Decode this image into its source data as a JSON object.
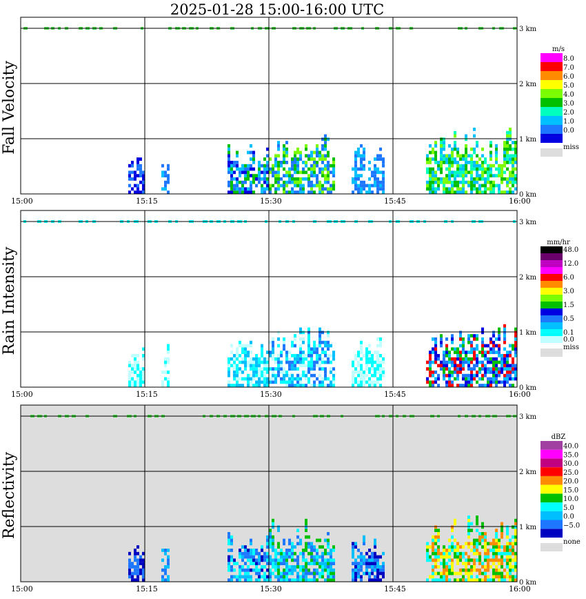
{
  "title": "2025-01-28   15:00-16:00 UTC",
  "chart_data": [
    {
      "type": "heatmap",
      "ylabel": "Fall Velocity",
      "x_ticks": [
        "15:00",
        "15:15",
        "15:30",
        "15:45",
        "16:00"
      ],
      "y_ticks": [
        "0 km",
        "1 km",
        "2 km",
        "3 km"
      ],
      "xlim": [
        "15:00",
        "16:00"
      ],
      "ylim": [
        0,
        3.2
      ],
      "grid": true,
      "background": "#ffffff",
      "legend": {
        "unit": "m/s",
        "placement": "right",
        "levels": [
          {
            "label": "8.0",
            "color": "#ff00ff"
          },
          {
            "label": "7.0",
            "color": "#ff0000"
          },
          {
            "label": "6.0",
            "color": "#ff8c00"
          },
          {
            "label": "5.0",
            "color": "#ffff00"
          },
          {
            "label": "4.0",
            "color": "#7cfc00"
          },
          {
            "label": "3.0",
            "color": "#00c000"
          },
          {
            "label": "2.0",
            "color": "#00ffbf"
          },
          {
            "label": "1.0",
            "color": "#00bfff"
          },
          {
            "label": "0.0",
            "color": "#1e78ff"
          },
          {
            "label": "",
            "color": "#0000e0"
          }
        ],
        "missing": {
          "label": "miss",
          "color": "#dddddd"
        }
      },
      "echoes": [
        {
          "t0": "15:13",
          "t1": "15:15",
          "z0": 0,
          "z1": 0.7,
          "colors": [
            "#0000e0",
            "#1e78ff"
          ]
        },
        {
          "t0": "15:17",
          "t1": "15:18",
          "z0": 0,
          "z1": 0.8,
          "colors": [
            "#1e78ff",
            "#00bfff"
          ]
        },
        {
          "t0": "15:25",
          "t1": "15:30",
          "z0": 0,
          "z1": 0.9,
          "colors": [
            "#1e78ff",
            "#00bfff",
            "#0000e0",
            "#00c000"
          ]
        },
        {
          "t0": "15:30",
          "t1": "15:38",
          "z0": 0,
          "z1": 1.1,
          "colors": [
            "#1e78ff",
            "#00bfff",
            "#00c000",
            "#7cfc00"
          ]
        },
        {
          "t0": "15:40",
          "t1": "15:44",
          "z0": 0,
          "z1": 0.9,
          "colors": [
            "#1e78ff",
            "#00bfff"
          ]
        },
        {
          "t0": "15:49",
          "t1": "16:00",
          "z0": 0,
          "z1": 1.2,
          "colors": [
            "#00bfff",
            "#00c000",
            "#7cfc00",
            "#00ffbf"
          ]
        }
      ]
    },
    {
      "type": "heatmap",
      "ylabel": "Rain Intensity",
      "x_ticks": [
        "15:00",
        "15:15",
        "15:30",
        "15:45",
        "16:00"
      ],
      "y_ticks": [
        "0 km",
        "1 km",
        "2 km",
        "3 km"
      ],
      "xlim": [
        "15:00",
        "16:00"
      ],
      "ylim": [
        0,
        3.2
      ],
      "grid": true,
      "background": "#ffffff",
      "legend": {
        "unit": "mm/hr",
        "placement": "right",
        "levels": [
          {
            "label": "48.0",
            "color": "#000000"
          },
          {
            "label": "",
            "color": "#6a006a"
          },
          {
            "label": "12.0",
            "color": "#c000c0"
          },
          {
            "label": "",
            "color": "#ff00ff"
          },
          {
            "label": "6.0",
            "color": "#ff0000"
          },
          {
            "label": "",
            "color": "#ff8c00"
          },
          {
            "label": "3.0",
            "color": "#ffff00"
          },
          {
            "label": "",
            "color": "#7cfc00"
          },
          {
            "label": "1.5",
            "color": "#00c000"
          },
          {
            "label": "",
            "color": "#0000e0"
          },
          {
            "label": "0.5",
            "color": "#1e78ff"
          },
          {
            "label": "",
            "color": "#00bfff"
          },
          {
            "label": "0.1",
            "color": "#00ffff"
          },
          {
            "label": "0.0",
            "color": "#bfffff"
          }
        ],
        "missing": {
          "label": "miss",
          "color": "#dddddd"
        }
      },
      "echoes": [
        {
          "t0": "15:13",
          "t1": "15:15",
          "z0": 0,
          "z1": 0.7,
          "colors": [
            "#00ffff",
            "#bfffff"
          ]
        },
        {
          "t0": "15:17",
          "t1": "15:18",
          "z0": 0,
          "z1": 0.8,
          "colors": [
            "#00ffff",
            "#bfffff"
          ]
        },
        {
          "t0": "15:25",
          "t1": "15:30",
          "z0": 0,
          "z1": 0.9,
          "colors": [
            "#00ffff",
            "#bfffff",
            "#00bfff"
          ]
        },
        {
          "t0": "15:30",
          "t1": "15:38",
          "z0": 0,
          "z1": 1.1,
          "colors": [
            "#00ffff",
            "#bfffff",
            "#00bfff",
            "#1e78ff"
          ]
        },
        {
          "t0": "15:40",
          "t1": "15:44",
          "z0": 0,
          "z1": 0.9,
          "colors": [
            "#00ffff",
            "#bfffff"
          ]
        },
        {
          "t0": "15:49",
          "t1": "16:00",
          "z0": 0,
          "z1": 1.2,
          "colors": [
            "#1e78ff",
            "#0000e0",
            "#00bfff",
            "#00c000",
            "#ff0000"
          ]
        }
      ]
    },
    {
      "type": "heatmap",
      "ylabel": "Reflectivity",
      "x_ticks": [
        "15:00",
        "15:15",
        "15:30",
        "15:45",
        "16:00"
      ],
      "y_ticks": [
        "0 km",
        "1 km",
        "2 km",
        "3 km"
      ],
      "xlim": [
        "15:00",
        "16:00"
      ],
      "ylim": [
        0,
        3.2
      ],
      "grid": true,
      "background": "#dddddd",
      "legend": {
        "unit": "dBZ",
        "placement": "right",
        "levels": [
          {
            "label": "40.0",
            "color": "#a040a0"
          },
          {
            "label": "35.0",
            "color": "#ff00ff"
          },
          {
            "label": "30.0",
            "color": "#c00080"
          },
          {
            "label": "25.0",
            "color": "#ff0000"
          },
          {
            "label": "20.0",
            "color": "#ff8c00"
          },
          {
            "label": "15.0",
            "color": "#ffff00"
          },
          {
            "label": "10.0",
            "color": "#00c000"
          },
          {
            "label": "5.0",
            "color": "#00ffff"
          },
          {
            "label": "0.0",
            "color": "#00bfff"
          },
          {
            "label": "−5.0",
            "color": "#1e78ff"
          },
          {
            "label": "",
            "color": "#0000c0"
          }
        ],
        "missing": {
          "label": "none",
          "color": "#dddddd"
        }
      },
      "echoes": [
        {
          "t0": "15:13",
          "t1": "15:15",
          "z0": 0,
          "z1": 0.7,
          "colors": [
            "#0000c0",
            "#1e78ff"
          ]
        },
        {
          "t0": "15:17",
          "t1": "15:18",
          "z0": 0,
          "z1": 0.8,
          "colors": [
            "#1e78ff",
            "#00bfff"
          ]
        },
        {
          "t0": "15:25",
          "t1": "15:30",
          "z0": 0,
          "z1": 0.9,
          "colors": [
            "#1e78ff",
            "#00bfff",
            "#0000c0",
            "#00ffff"
          ]
        },
        {
          "t0": "15:30",
          "t1": "15:38",
          "z0": 0,
          "z1": 1.1,
          "colors": [
            "#00bfff",
            "#00ffff",
            "#1e78ff",
            "#00c000"
          ]
        },
        {
          "t0": "15:40",
          "t1": "15:44",
          "z0": 0,
          "z1": 0.9,
          "colors": [
            "#1e78ff",
            "#00bfff",
            "#0000c0"
          ]
        },
        {
          "t0": "15:49",
          "t1": "16:00",
          "z0": 0,
          "z1": 1.2,
          "colors": [
            "#00ffff",
            "#00c000",
            "#ffff00",
            "#ff8c00"
          ]
        }
      ]
    }
  ]
}
